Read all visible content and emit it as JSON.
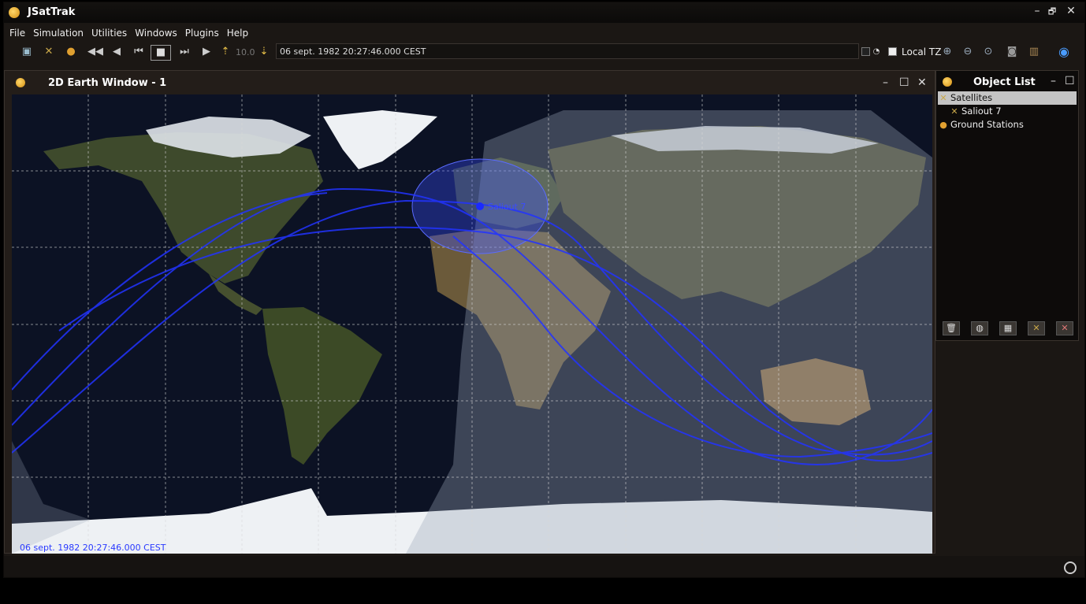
{
  "app": {
    "title": "JSatTrak"
  },
  "window_controls": {
    "minimize": "–",
    "restore": "🗗",
    "close": "✕"
  },
  "menubar": {
    "items": [
      "File",
      "Simulation",
      "Utilities",
      "Windows",
      "Plugins",
      "Help"
    ]
  },
  "toolbar": {
    "time_step": "10.0",
    "current_time": "06 sept. 1982 20:27:46.000 CEST",
    "local_tz_label": "Local TZ",
    "local_tz_checked": true
  },
  "earth_window": {
    "title": "2D Earth Window - 1",
    "map_time_label": "06 sept. 1982 20:27:46.000 CEST",
    "satellite_label": "Saliout 7"
  },
  "object_list": {
    "title": "Object List",
    "items": [
      {
        "label": "Satellites",
        "icon": "satellite-icon",
        "selected": true
      },
      {
        "label": "Saliout 7",
        "icon": "satellite-icon",
        "indent": true
      },
      {
        "label": "Ground Stations",
        "icon": "ground-station-icon"
      }
    ]
  },
  "colors": {
    "orbit": "#2233ff",
    "footprint": "#3a4cff",
    "night": "#0c1224",
    "day_overlay": "#9aa6b8",
    "ice": "#f2f4f7"
  }
}
